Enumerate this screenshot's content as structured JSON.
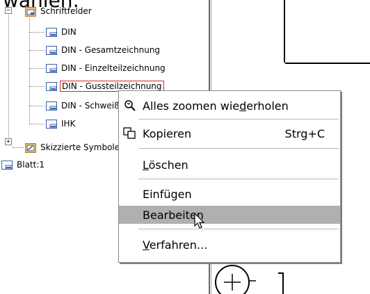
{
  "heading": "wählen:",
  "tree": {
    "root_label": "Schriftfelder",
    "children": [
      "DIN",
      "DIN - Gesamtzeichnung",
      "DIN - Einzelteilzeichnung",
      "DIN - Gussteilzeichnung",
      "DIN - Schweißteilzeichnung",
      "IHK"
    ],
    "selected_index": 3,
    "sibling_label": "Skizzierte Symbole",
    "sheet_label": "Blatt:1",
    "expand_symbol": "+",
    "collapse_symbol": "−"
  },
  "menu": {
    "items": [
      {
        "pre": "Alles zoomen wie",
        "acc_char": "d",
        "post": "erholen",
        "shortcut": ""
      },
      {
        "pre": "Kopieren",
        "acc_char": "",
        "post": "",
        "shortcut": "Strg+C"
      },
      {
        "pre": "",
        "acc_char": "L",
        "post": "öschen",
        "shortcut": ""
      },
      {
        "pre": "Einfügen",
        "acc_char": "",
        "post": "",
        "shortcut": ""
      },
      {
        "pre": "Bearbeiten",
        "acc_char": "",
        "post": "",
        "shortcut": ""
      },
      {
        "pre": "",
        "acc_char": "V",
        "post": "erfahren...",
        "shortcut": ""
      }
    ],
    "highlighted_index": 4
  },
  "colors": {
    "selection_border": "#e02020",
    "menu_highlight": "#b0b0b0",
    "folder": "#e8a23a"
  },
  "icons": {
    "zoom_item": "zoom-icon",
    "copy_item": "copy-icon",
    "sheet": "sheet-icon",
    "folder": "folder-icon"
  }
}
